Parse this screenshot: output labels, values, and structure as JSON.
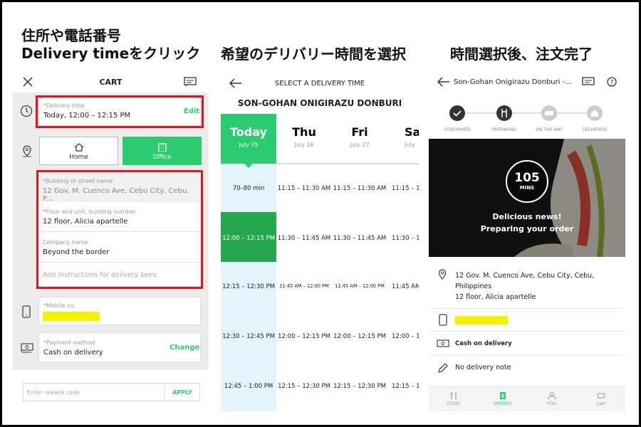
{
  "captions": {
    "c1_line1": "住所や電話番号",
    "c1_line2": "Delivery timeをクリック",
    "c2": "希望のデリバリー時間を選択",
    "c3": "時間選択後、注文完了"
  },
  "cart": {
    "title": "CART",
    "delivery_label": "*Delivery time",
    "delivery_value": "Today, 12:00 – 12:15 PM",
    "edit": "Edit",
    "home": "Home",
    "office": "Office",
    "building_label": "*Building or street name",
    "building_value": "12 Gov. M. Cuenco Ave, Cebu City, Cebu, P...",
    "floor_label": "*Floor and unit, building number",
    "floor_value": "12 floor, Alicia apartelle",
    "company_label": "Company name",
    "company_value": "Beyond the border",
    "instructions_placeholder": "Add instructions for delivery bees",
    "mobile_label": "*Mobile no.",
    "payment_label": "*Payment method",
    "payment_value": "Cash on delivery",
    "change": "Change",
    "reward_placeholder": "Enter reward code",
    "apply": "APPLY"
  },
  "schedule": {
    "title": "SELECT A DELIVERY TIME",
    "restaurant": "SON-GOHAN ONIGIRAZU DONBURI",
    "days": [
      {
        "day": "Today",
        "date": "July 25"
      },
      {
        "day": "Thu",
        "date": "July 26"
      },
      {
        "day": "Fri",
        "date": "July 27"
      },
      {
        "day": "Sa",
        "date": "July"
      }
    ],
    "col0": [
      "70–80 min",
      "12:00 – 12:15 PM",
      "12:15 – 12:30 PM",
      "12:30 – 12:45 PM",
      "12:45 – 1:00 PM"
    ],
    "col1": [
      "11:15 – 11:30 AM",
      "11:30 – 11:45 AM",
      "11:45 AM – 12:00 PM",
      "12:00 – 12:15 PM",
      "12:15 – 12:30 PM"
    ],
    "col2": [
      "11:15 – 11:30 AM",
      "11:30 – 11:45 AM",
      "11:45 AM – 12:00 PM",
      "12:00 – 12:15 PM",
      "12:15 – 12:30 PM"
    ],
    "col3": [
      "11:15 – 1",
      "11:30 – 1",
      "11:45 AM –",
      "12:00 – 1",
      "12:15 – 1"
    ]
  },
  "order": {
    "title": "Son-Gohan Onigirazu Donburi -...",
    "steps": [
      "CONFIRMED",
      "PREPARING",
      "ON THE WAY",
      "DELIVERED"
    ],
    "mins": "105",
    "mins_label": "MINS",
    "msg1": "Delicious news!",
    "msg2": "Preparing your order",
    "addr1": "12 Gov. M. Cuenco Ave, Cebu City, Cebu,",
    "addr2": "Philippines",
    "addr3": "12 floor, Alicia apartelle",
    "payment": "Cash on delivery",
    "note": "No delivery note",
    "tabs": [
      "FOOD",
      "ORDERS",
      "YOU",
      "Cart"
    ]
  }
}
